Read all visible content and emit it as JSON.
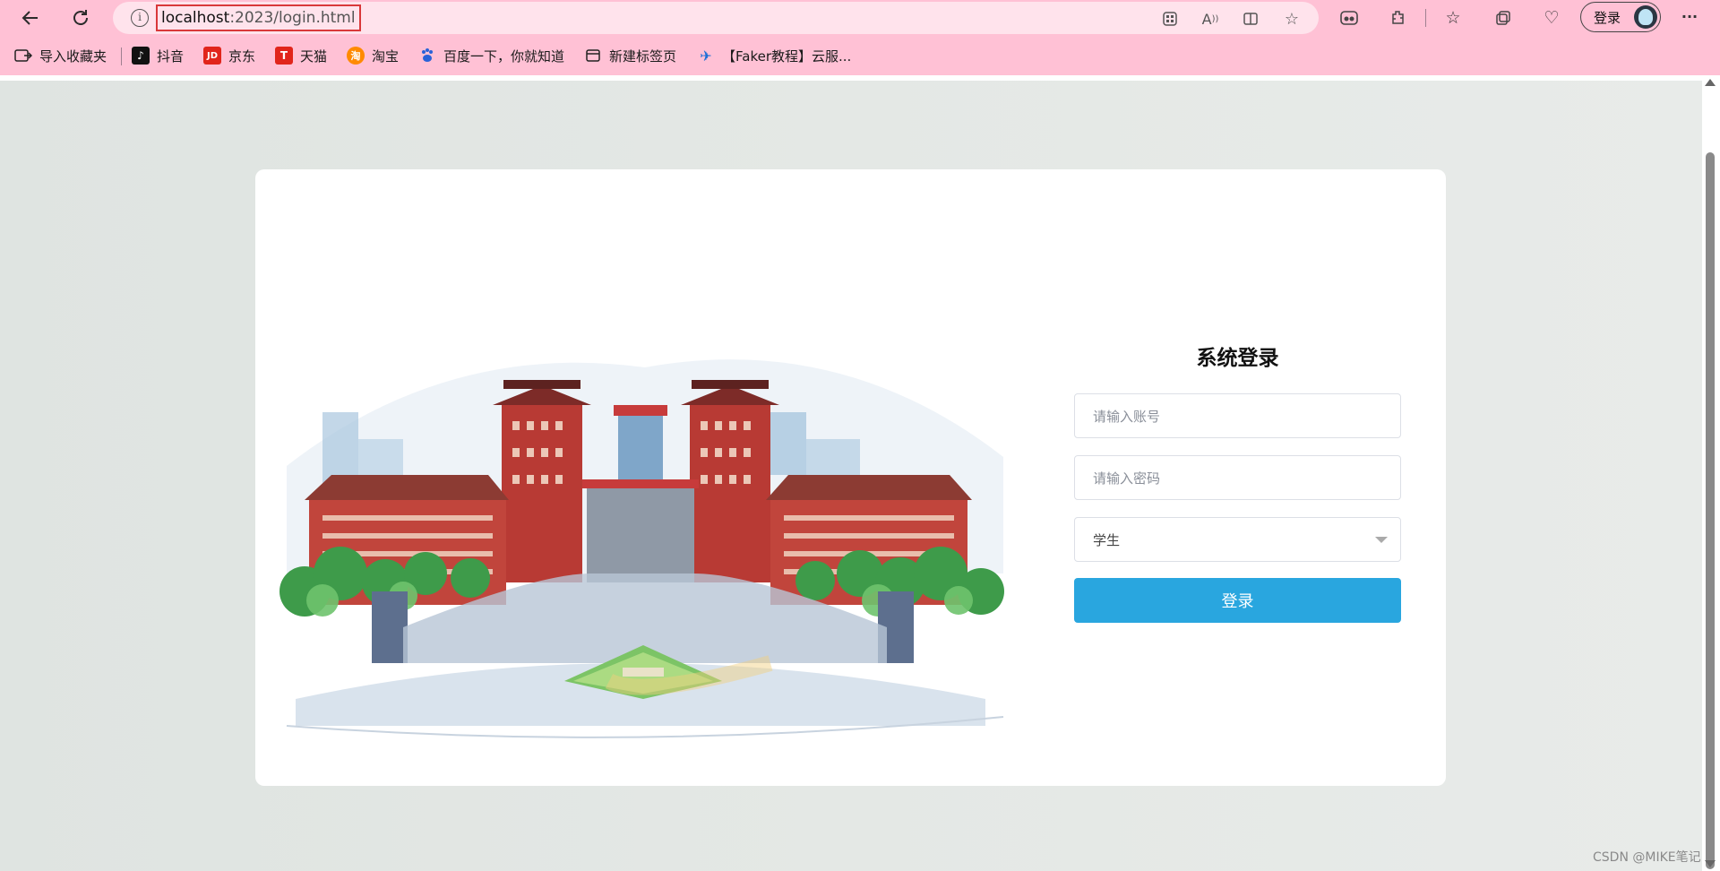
{
  "browser": {
    "url_host": "localhost",
    "url_rest": ":2023/login.html",
    "profile_login_label": "登录",
    "more_label": "···"
  },
  "bookmarks": [
    {
      "label": "导入收藏夹",
      "icon": "import-icon"
    },
    {
      "label": "抖音",
      "icon": "douyin-icon"
    },
    {
      "label": "京东",
      "icon": "jd-icon"
    },
    {
      "label": "天猫",
      "icon": "tmall-icon"
    },
    {
      "label": "淘宝",
      "icon": "taobao-icon"
    },
    {
      "label": "百度一下，你就知道",
      "icon": "baidu-icon"
    },
    {
      "label": "新建标签页",
      "icon": "new-tab-icon"
    },
    {
      "label": "【Faker教程】云服...",
      "icon": "plane-icon"
    }
  ],
  "bookmark_icon_text": {
    "jd": "JD",
    "tmall": "T",
    "taobao": "淘"
  },
  "login": {
    "title": "系统登录",
    "account_placeholder": "请输入账号",
    "password_placeholder": "请输入密码",
    "role_selected": "学生",
    "submit_label": "登录"
  },
  "watermark": "CSDN @MIKE笔记",
  "colors": {
    "browser_chrome": "#ffc1d5",
    "address_bar": "#ffe3ec",
    "url_highlight_border": "#d9383a",
    "login_button": "#29a6df",
    "page_background": "#dfe3e1"
  }
}
